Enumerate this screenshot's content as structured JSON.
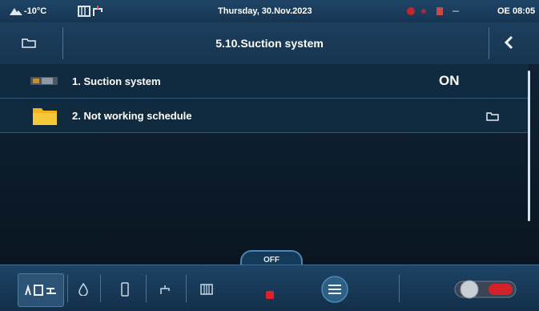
{
  "status": {
    "temperature": "-10°C",
    "date": "Thursday, 30.Nov.2023",
    "time": "OE 08:05"
  },
  "header": {
    "title": "5.10.Suction system"
  },
  "menu": {
    "items": [
      {
        "label": "1. Suction system",
        "value": "ON"
      },
      {
        "label": "2. Not working schedule"
      }
    ]
  },
  "bottom": {
    "mode_label": "OFF"
  },
  "colors": {
    "accent_red": "#e0202a",
    "folder_yellow": "#f2b31c",
    "header_blue": "#1d3f5e"
  }
}
